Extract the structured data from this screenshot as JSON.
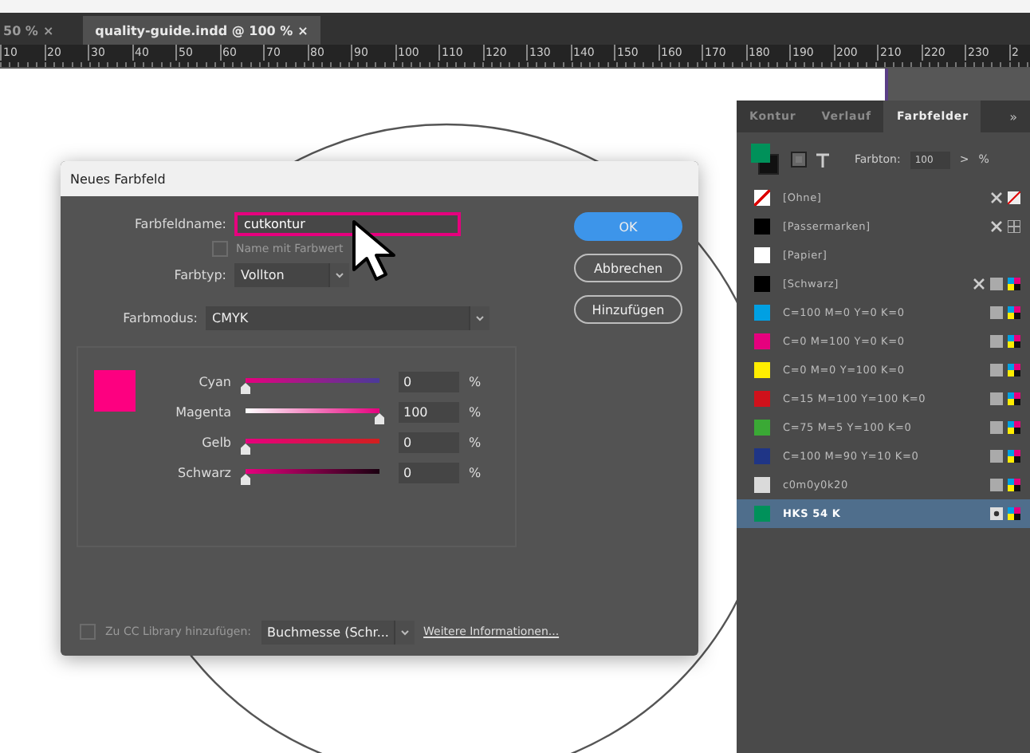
{
  "document_tabs": [
    {
      "label": "50 %",
      "close": "×",
      "selected": false
    },
    {
      "label": "quality-guide.indd @ 100 %",
      "close": "×",
      "selected": true
    }
  ],
  "ruler": [
    "10",
    "20",
    "30",
    "40",
    "50",
    "60",
    "70",
    "80",
    "90",
    "100",
    "110",
    "120",
    "130",
    "140",
    "150",
    "160",
    "170",
    "180",
    "190",
    "200",
    "210",
    "220",
    "230",
    "2"
  ],
  "dialog": {
    "title": "Neues Farbfeld",
    "name_label": "Farbfeldname:",
    "name_value": "cutkontur",
    "name_with_value": {
      "label": "Name mit Farbwert",
      "checked": false,
      "disabled": true
    },
    "type_label": "Farbtyp:",
    "type_value": "Vollton",
    "mode_label": "Farbmodus:",
    "mode_value": "CMYK",
    "channels": [
      {
        "name": "Cyan",
        "level": 0,
        "value": "0",
        "unit": "%"
      },
      {
        "name": "Magenta",
        "level": 1,
        "value": "100",
        "unit": "%"
      },
      {
        "name": "Gelb",
        "level": 0,
        "value": "0",
        "unit": "%"
      },
      {
        "name": "Schwarz",
        "level": 0,
        "value": "0",
        "unit": "%"
      }
    ],
    "buttons": [
      {
        "label": "OK",
        "kind": "primary"
      },
      {
        "label": "Abbrechen",
        "kind": "secondary"
      },
      {
        "label": "Hinzufügen",
        "kind": "secondary"
      }
    ],
    "library": {
      "label": "Zu CC Library hinzufügen:",
      "checked": false,
      "disabled": true
    },
    "library_value": "Buchmesse (Schr...",
    "link": "Weitere Informationen..."
  },
  "panel": {
    "tabs": [
      {
        "label": "Kontur",
        "selected": false
      },
      {
        "label": "Verlauf",
        "selected": false
      },
      {
        "label": "Farbfelder",
        "selected": true
      }
    ],
    "more": "»",
    "tint_label": "Farbton:",
    "tint_value": "100",
    "tint_arrow": ">",
    "tint_unit": "%",
    "swatches": [
      {
        "name": "[Ohne]",
        "kind": "none",
        "color": "#ffffff",
        "selected": false
      },
      {
        "name": "[Passermarken]",
        "kind": "registration",
        "color": "#000000",
        "selected": false
      },
      {
        "name": "[Papier]",
        "kind": "paper",
        "color": "#ffffff",
        "selected": false
      },
      {
        "name": "[Schwarz]",
        "kind": "black",
        "color": "#000000",
        "selected": false
      },
      {
        "name": "C=100 M=0 Y=0 K=0",
        "kind": "process",
        "color": "#00a0e3",
        "selected": false
      },
      {
        "name": "C=0 M=100 Y=0 K=0",
        "kind": "process",
        "color": "#e6007e",
        "selected": false
      },
      {
        "name": "C=0 M=0 Y=100 K=0",
        "kind": "process",
        "color": "#ffed00",
        "selected": false
      },
      {
        "name": "C=15 M=100 Y=100 K=0",
        "kind": "process",
        "color": "#d0111b",
        "selected": false
      },
      {
        "name": "C=75 M=5 Y=100 K=0",
        "kind": "process",
        "color": "#3aa935",
        "selected": false
      },
      {
        "name": "C=100 M=90 Y=10 K=0",
        "kind": "process",
        "color": "#1f3586",
        "selected": false
      },
      {
        "name": "c0m0y0k20",
        "kind": "process",
        "color": "#dadada",
        "selected": false
      },
      {
        "name": "HKS 54 K",
        "kind": "spot",
        "color": "#00915a",
        "selected": true
      }
    ]
  }
}
